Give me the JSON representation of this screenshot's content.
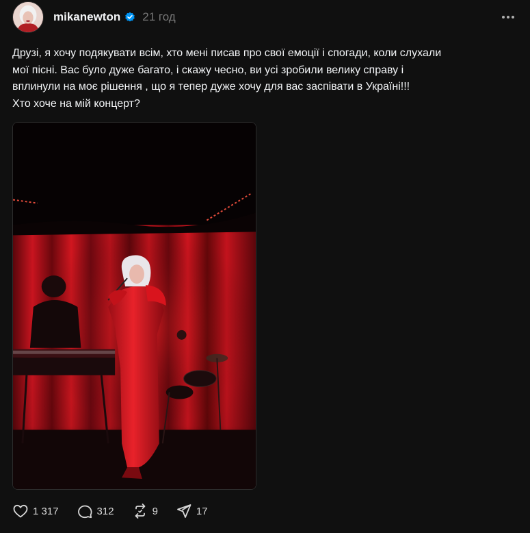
{
  "post": {
    "username": "mikanewton",
    "time": "21 год",
    "caption_lines": [
      "Друзі, я хочу подякувати всім, хто мені писав про свої емоції і спогади, коли слухали",
      "мої пісні. Вас було дуже багато, і скажу чесно, ви усі зробили велику справу і",
      "вплинули на моє рішення , що я тепер дуже хочу для вас заспівати в Україні!!!",
      "Хто хоче на мій концерт?"
    ],
    "stats": {
      "likes": "1 317",
      "replies": "312",
      "reposts": "9",
      "shares": "17"
    }
  },
  "icons": {
    "verified": "verified-badge-icon",
    "more": "more-options-icon",
    "like": "heart-icon",
    "reply": "comment-bubble-icon",
    "repost": "repost-icon",
    "share": "send-icon"
  },
  "colors": {
    "background": "#101010",
    "text": "#f3f5f7",
    "muted": "#777777",
    "verified": "#0095f6",
    "curtain": "#b3121c"
  }
}
